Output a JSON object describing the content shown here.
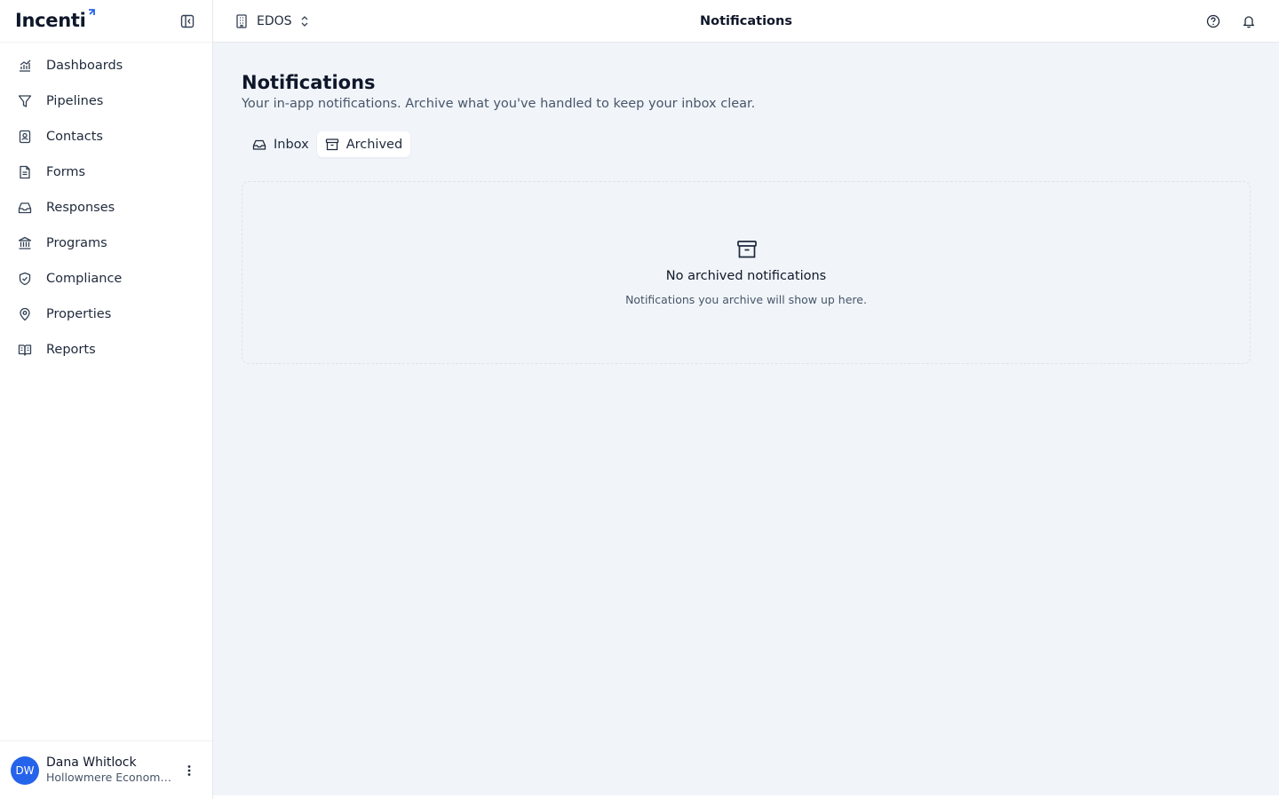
{
  "brand": {
    "name": "Incenti",
    "accent": "#2563eb"
  },
  "sidebar": {
    "collapse_icon": "sidebar-collapse-icon",
    "items": [
      {
        "label": "Dashboards",
        "icon": "chart-line-icon"
      },
      {
        "label": "Pipelines",
        "icon": "filter-funnel-icon"
      },
      {
        "label": "Contacts",
        "icon": "contact-book-icon"
      },
      {
        "label": "Forms",
        "icon": "file-text-icon"
      },
      {
        "label": "Responses",
        "icon": "inbox-icon"
      },
      {
        "label": "Programs",
        "icon": "landmark-icon"
      },
      {
        "label": "Compliance",
        "icon": "shield-check-icon"
      },
      {
        "label": "Properties",
        "icon": "map-pin-icon"
      },
      {
        "label": "Reports",
        "icon": "open-book-icon"
      }
    ],
    "user": {
      "initials": "DW",
      "name": "Dana Whitlock",
      "org": "Hollowmere Economic Development",
      "avatar_color": "#2563eb"
    }
  },
  "topbar": {
    "org_switcher": "EDOS",
    "title": "Notifications"
  },
  "page": {
    "title": "Notifications",
    "subtitle": "Your in-app notifications. Archive what you've handled to keep your inbox clear.",
    "tabs": [
      {
        "label": "Inbox",
        "active": false
      },
      {
        "label": "Archived",
        "active": true
      }
    ],
    "empty_state": {
      "title": "No archived notifications",
      "description": "Notifications you archive will show up here."
    }
  }
}
